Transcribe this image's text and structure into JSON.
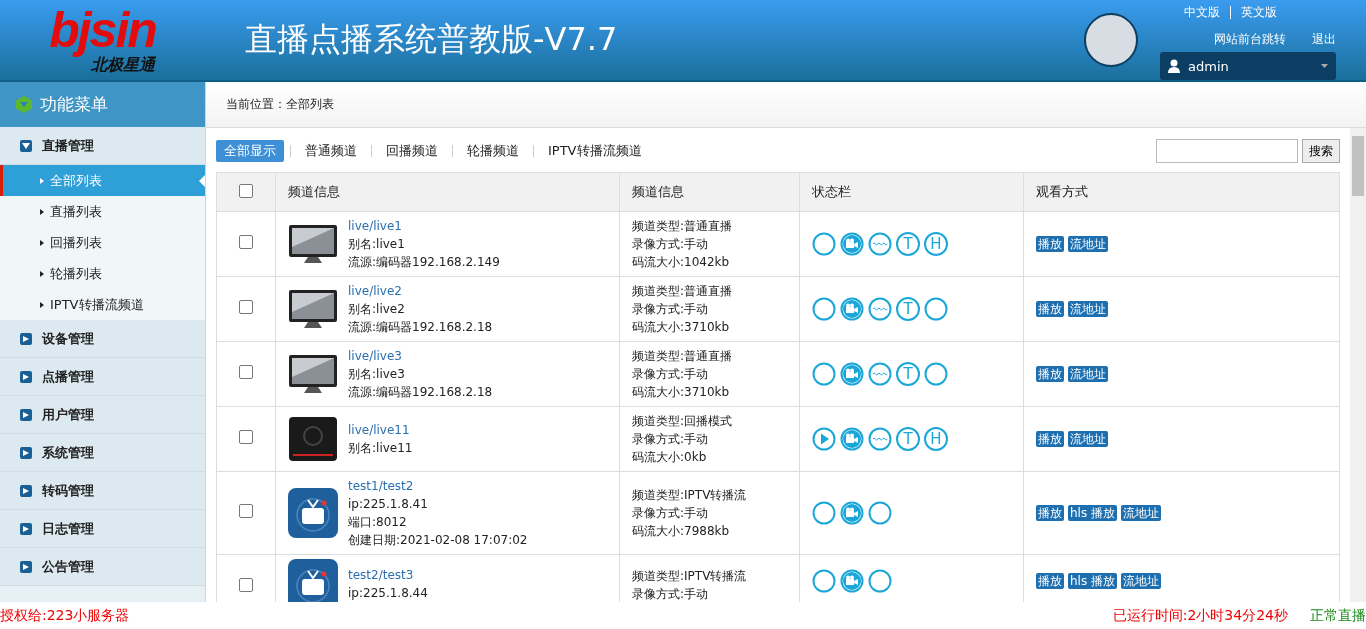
{
  "header": {
    "logo": "bjsin",
    "logo_subtitle": "北极星通",
    "title": "直播点播系统普教版-V7.7",
    "languages": [
      "中文版",
      "英文版"
    ],
    "links": [
      "网站前台跳转",
      "退出"
    ],
    "user": "admin"
  },
  "sidebar": {
    "title": "功能菜单",
    "groups": [
      {
        "label": "直播管理",
        "expanded": true,
        "items": [
          {
            "label": "全部列表",
            "selected": true
          },
          {
            "label": "直播列表",
            "selected": false
          },
          {
            "label": "回播列表",
            "selected": false
          },
          {
            "label": "轮播列表",
            "selected": false
          },
          {
            "label": "IPTV转播流频道",
            "selected": false
          }
        ]
      },
      {
        "label": "设备管理",
        "expanded": false
      },
      {
        "label": "点播管理",
        "expanded": false
      },
      {
        "label": "用户管理",
        "expanded": false
      },
      {
        "label": "系统管理",
        "expanded": false
      },
      {
        "label": "转码管理",
        "expanded": false
      },
      {
        "label": "日志管理",
        "expanded": false
      },
      {
        "label": "公告管理",
        "expanded": false
      }
    ]
  },
  "breadcrumb": "当前位置：全部列表",
  "filters": [
    {
      "label": "全部显示",
      "selected": true
    },
    {
      "label": "普通频道",
      "selected": false
    },
    {
      "label": "回播频道",
      "selected": false
    },
    {
      "label": "轮播频道",
      "selected": false
    },
    {
      "label": "IPTV转播流频道",
      "selected": false
    }
  ],
  "search": {
    "button": "搜索"
  },
  "table": {
    "select_all": false,
    "columns": [
      "频道信息",
      "频道信息",
      "状态栏",
      "观看方式"
    ],
    "rows": [
      {
        "checked": false,
        "thumbnail": {
          "kind": "monitor"
        },
        "name": "live/live1",
        "details": [
          "别名:live1",
          "流源:编码器192.168.2.149"
        ],
        "info": [
          "频道类型:普通直播",
          "录像方式:手动",
          "码流大小:1042kb"
        ],
        "status": [
          {
            "kind": "blank"
          },
          {
            "kind": "camera"
          },
          {
            "kind": "wave"
          },
          {
            "kind": "letter",
            "text": "T"
          },
          {
            "kind": "letter",
            "text": "H"
          }
        ],
        "actions": [
          "播放",
          "流地址"
        ]
      },
      {
        "checked": false,
        "thumbnail": {
          "kind": "monitor"
        },
        "name": "live/live2",
        "details": [
          "别名:live2",
          "流源:编码器192.168.2.18"
        ],
        "info": [
          "频道类型:普通直播",
          "录像方式:手动",
          "码流大小:3710kb"
        ],
        "status": [
          {
            "kind": "blank"
          },
          {
            "kind": "camera"
          },
          {
            "kind": "wave"
          },
          {
            "kind": "letter",
            "text": "T"
          },
          {
            "kind": "blank"
          }
        ],
        "actions": [
          "播放",
          "流地址"
        ]
      },
      {
        "checked": false,
        "thumbnail": {
          "kind": "monitor"
        },
        "name": "live/live3",
        "details": [
          "别名:live3",
          "流源:编码器192.168.2.18"
        ],
        "info": [
          "频道类型:普通直播",
          "录像方式:手动",
          "码流大小:3710kb"
        ],
        "status": [
          {
            "kind": "blank"
          },
          {
            "kind": "camera"
          },
          {
            "kind": "wave"
          },
          {
            "kind": "letter",
            "text": "T"
          },
          {
            "kind": "blank"
          }
        ],
        "actions": [
          "播放",
          "流地址"
        ]
      },
      {
        "checked": false,
        "thumbnail": {
          "kind": "player"
        },
        "name": "live/live11",
        "details": [
          "别名:live11"
        ],
        "info": [
          "频道类型:回播模式",
          "录像方式:手动",
          "码流大小:0kb"
        ],
        "status": [
          {
            "kind": "play"
          },
          {
            "kind": "camera"
          },
          {
            "kind": "wave"
          },
          {
            "kind": "letter",
            "text": "T"
          },
          {
            "kind": "letter",
            "text": "H"
          }
        ],
        "actions": [
          "播放",
          "流地址"
        ]
      },
      {
        "checked": false,
        "thumbnail": {
          "kind": "iptv"
        },
        "name": "test1/test2",
        "details": [
          "ip:225.1.8.41",
          "端口:8012",
          "创建日期:2021-02-08 17:07:02"
        ],
        "info": [
          "频道类型:IPTV转播流",
          "录像方式:手动",
          "码流大小:7988kb"
        ],
        "status": [
          {
            "kind": "blank"
          },
          {
            "kind": "camera"
          },
          {
            "kind": "blank"
          }
        ],
        "actions": [
          "播放",
          "hls 播放",
          "流地址"
        ]
      },
      {
        "checked": false,
        "thumbnail": {
          "kind": "iptv"
        },
        "name": "test2/test3",
        "details": [
          "ip:225.1.8.44"
        ],
        "info": [
          "频道类型:IPTV转播流",
          "录像方式:手动"
        ],
        "status": [
          {
            "kind": "blank"
          },
          {
            "kind": "camera"
          },
          {
            "kind": "blank"
          }
        ],
        "actions": [
          "播放",
          "hls 播放",
          "流地址"
        ]
      }
    ]
  },
  "footer": {
    "license": "授权给:223小服务器",
    "uptime": "已运行时间:2小时34分24秒",
    "state": "正常直播"
  }
}
